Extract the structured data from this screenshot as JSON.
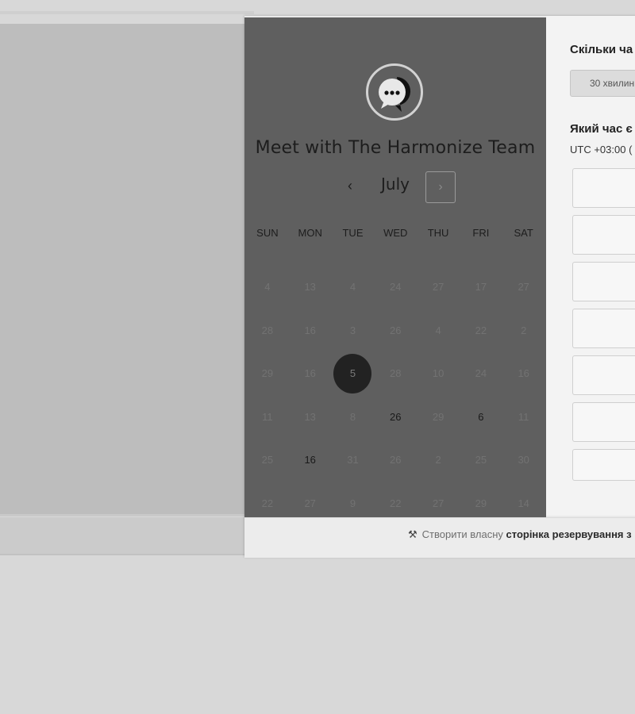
{
  "scheduler": {
    "title": "Meet with The Harmonize Team",
    "month": "July",
    "prev_icon": "‹",
    "next_icon": "›",
    "weekdays": [
      "SUN",
      "MON",
      "TUE",
      "WED",
      "THU",
      "FRI",
      "SAT"
    ],
    "weeks": [
      [
        {
          "d": "4",
          "s": "muted"
        },
        {
          "d": "13",
          "s": "muted"
        },
        {
          "d": "4",
          "s": "muted"
        },
        {
          "d": "24",
          "s": "muted"
        },
        {
          "d": "27",
          "s": "muted"
        },
        {
          "d": "17",
          "s": "muted"
        },
        {
          "d": "27",
          "s": "muted"
        }
      ],
      [
        {
          "d": "28",
          "s": "muted"
        },
        {
          "d": "16",
          "s": "muted"
        },
        {
          "d": "3",
          "s": "muted"
        },
        {
          "d": "26",
          "s": "muted"
        },
        {
          "d": "4",
          "s": "muted"
        },
        {
          "d": "22",
          "s": "muted"
        },
        {
          "d": "2",
          "s": "muted"
        }
      ],
      [
        {
          "d": "29",
          "s": "muted"
        },
        {
          "d": "16",
          "s": "muted"
        },
        {
          "d": "5",
          "s": "selected"
        },
        {
          "d": "28",
          "s": "muted"
        },
        {
          "d": "10",
          "s": "muted"
        },
        {
          "d": "24",
          "s": "muted"
        },
        {
          "d": "16",
          "s": "muted"
        }
      ],
      [
        {
          "d": "11",
          "s": "muted"
        },
        {
          "d": "13",
          "s": "muted"
        },
        {
          "d": "8",
          "s": "muted"
        },
        {
          "d": "26",
          "s": "avail"
        },
        {
          "d": "29",
          "s": "muted"
        },
        {
          "d": "6",
          "s": "avail"
        },
        {
          "d": "11",
          "s": "muted"
        }
      ],
      [
        {
          "d": "25",
          "s": "muted"
        },
        {
          "d": "16",
          "s": "avail"
        },
        {
          "d": "31",
          "s": "muted"
        },
        {
          "d": "26",
          "s": "muted"
        },
        {
          "d": "2",
          "s": "muted"
        },
        {
          "d": "25",
          "s": "muted"
        },
        {
          "d": "30",
          "s": "muted"
        }
      ],
      [
        {
          "d": "22",
          "s": "muted"
        },
        {
          "d": "27",
          "s": "muted"
        },
        {
          "d": "9",
          "s": "muted"
        },
        {
          "d": "22",
          "s": "muted"
        },
        {
          "d": "27",
          "s": "muted"
        },
        {
          "d": "29",
          "s": "muted"
        },
        {
          "d": "14",
          "s": "muted"
        }
      ]
    ]
  },
  "booking": {
    "duration_question": "Скільки ча",
    "duration_option": "30 хвилин",
    "time_question": "Який час є",
    "timezone": "UTC +03:00 (",
    "slot_count": 7
  },
  "footer": {
    "prefix": "Створити власну",
    "link": "сторінка резервування з"
  }
}
